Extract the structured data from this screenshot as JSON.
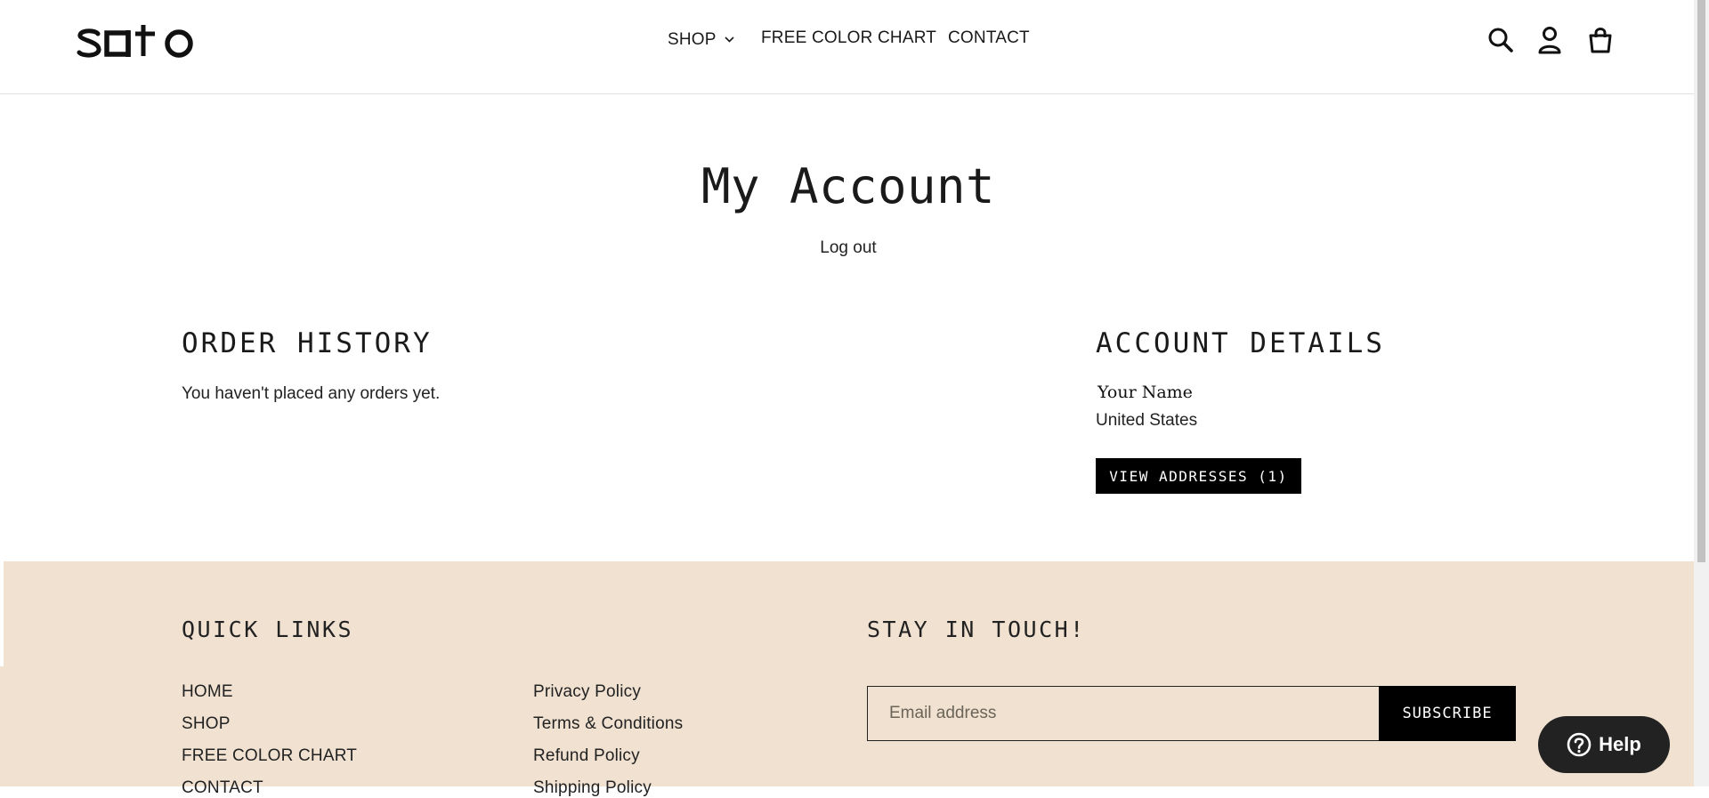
{
  "brand": {
    "logo_text": "sato"
  },
  "nav": {
    "items": [
      {
        "label": "SHOP",
        "has_dropdown": true
      },
      {
        "label": "FREE COLOR CHART"
      },
      {
        "label": "CONTACT"
      }
    ]
  },
  "header_icons": [
    "search-icon",
    "account-icon",
    "cart-icon"
  ],
  "main": {
    "title": "My Account",
    "logout_label": "Log out",
    "order_history": {
      "title": "ORDER HISTORY",
      "empty_text": "You haven't placed any orders yet."
    },
    "account_details": {
      "title": "ACCOUNT DETAILS",
      "name": "Your Name",
      "country": "United States",
      "view_addresses_label": "VIEW ADDRESSES (1)"
    }
  },
  "footer": {
    "quick_links_title": "QUICK LINKS",
    "links_col1": [
      "HOME",
      "SHOP",
      "FREE COLOR CHART",
      "CONTACT"
    ],
    "links_col2": [
      "Privacy Policy",
      "Terms & Conditions",
      "Refund Policy",
      "Shipping Policy"
    ],
    "newsletter_title": "STAY IN TOUCH!",
    "email_placeholder": "Email address",
    "subscribe_label": "SUBSCRIBE",
    "background": "#f0e1d1"
  },
  "help": {
    "label": "Help"
  }
}
